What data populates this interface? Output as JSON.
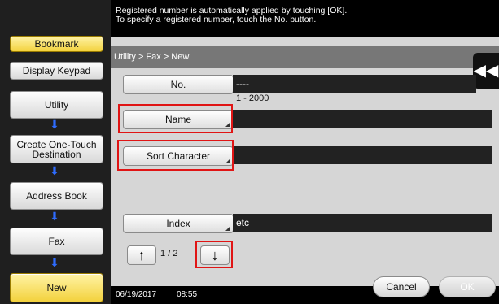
{
  "top": {
    "message_line1": "Registered number is automatically applied by touching [OK].",
    "message_line2": "To specify a registered number, touch the No. button."
  },
  "sidebar": {
    "bookmark": "Bookmark",
    "display_keypad": "Display Keypad",
    "steps": [
      {
        "label": "Utility"
      },
      {
        "label": "Create One-Touch Destination"
      },
      {
        "label": "Address Book"
      },
      {
        "label": "Fax"
      },
      {
        "label": "New"
      }
    ]
  },
  "main": {
    "breadcrumb": "Utility > Fax > New",
    "no": {
      "label": "No.",
      "value": "----",
      "range": "1 - 2000"
    },
    "name": {
      "label": "Name",
      "value": ""
    },
    "sort_character": {
      "label": "Sort Character",
      "value": ""
    },
    "index": {
      "label": "Index",
      "value": "etc"
    },
    "pager": {
      "current": "1",
      "separator": "/",
      "total": "2"
    }
  },
  "status": {
    "date": "06/19/2017",
    "time": "08:55",
    "cancel": "Cancel",
    "ok": "OK"
  },
  "icons": {
    "step_arrow": "arrow-down-icon",
    "collapse": "rewind-icon",
    "page_up": "arrow-up-icon",
    "page_down": "arrow-down-icon"
  },
  "colors": {
    "highlight": "#e01515",
    "step_arrow": "#2e6cff",
    "bookmark_bg": "#f3d23d"
  }
}
